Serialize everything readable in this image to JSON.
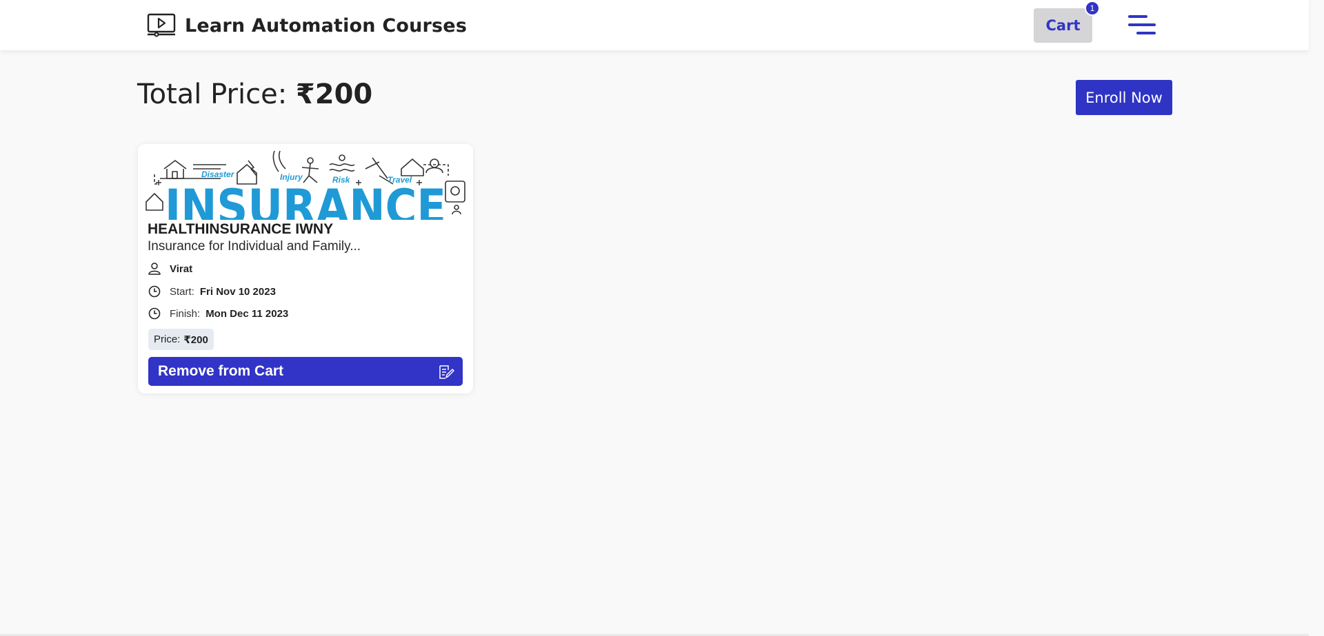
{
  "header": {
    "brand_title": "Learn Automation Courses",
    "cart_label": "Cart",
    "cart_count": "1"
  },
  "summary": {
    "total_label": "Total Price:",
    "total_value": "₹200",
    "enroll_label": "Enroll Now"
  },
  "course": {
    "banner": {
      "word": "INSURANCE",
      "tags": [
        "Disaster",
        "Injury",
        "Risk",
        "Travel"
      ]
    },
    "title": "HEALTHINSURANCE IWNY",
    "description": "Insurance for Individual and Family...",
    "author": "Virat",
    "start_label": "Start:",
    "start_date": "Fri Nov 10 2023",
    "finish_label": "Finish:",
    "finish_date": "Mon Dec 11 2023",
    "price_label": "Price:",
    "price_value": "₹200",
    "remove_label": "Remove from Cart"
  },
  "colors": {
    "accent": "#3134c6",
    "banner_blue": "#1f9ad6",
    "background": "#f8f9f8"
  }
}
